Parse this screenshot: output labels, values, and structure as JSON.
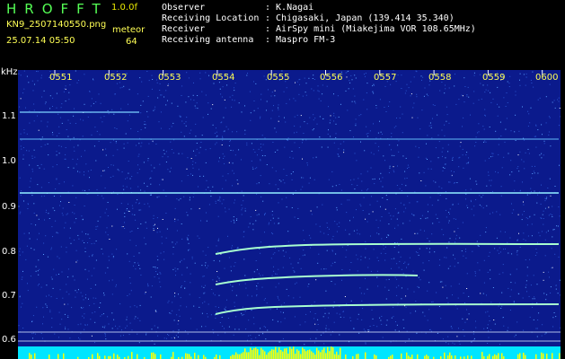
{
  "header": {
    "logo": "HROFFT",
    "version": "1.0.0f",
    "filename": "KN9_2507140550.png",
    "datetime": "25.07.14 05:50",
    "meteor_label": "meteor",
    "meteor_count": "64",
    "info": [
      {
        "key": "Observer",
        "value": ": K.Nagai"
      },
      {
        "key": "Receiving Location",
        "value": ": Chigasaki, Japan (139.414 35.340)"
      },
      {
        "key": "Receiver",
        "value": ": AirSpy mini (Miakejima VOR 108.65MHz)"
      },
      {
        "key": "Receiving antenna",
        "value": ": Maspro FM-3"
      }
    ]
  },
  "spectrogram": {
    "y_unit": "kHz",
    "y_ticks": [
      "1.1",
      "1.0",
      "0.9",
      "0.8",
      "0.7",
      "0.6"
    ],
    "x_ticks": [
      "0551",
      "0552",
      "0553",
      "0554",
      "0555",
      "0556",
      "0557",
      "0558",
      "0559",
      "0600"
    ],
    "colors": {
      "background": "#0b1a8c",
      "noise": "#3a7dff",
      "signal": "#9af0c0",
      "baseline": "#ffff00",
      "cyan": "#00e5ff"
    }
  }
}
